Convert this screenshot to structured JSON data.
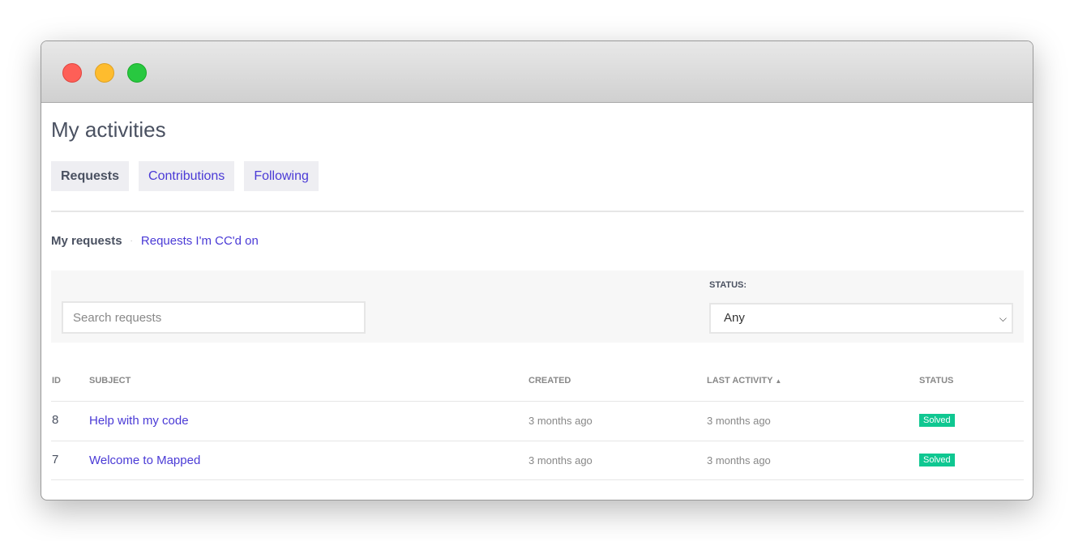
{
  "window": {
    "controls": [
      {
        "name": "close",
        "color": "#fe5f57"
      },
      {
        "name": "minimize",
        "color": "#febc2e"
      },
      {
        "name": "zoom",
        "color": "#28c840"
      }
    ]
  },
  "page": {
    "title": "My activities"
  },
  "tabs": [
    {
      "label": "Requests",
      "active": true
    },
    {
      "label": "Contributions"
    },
    {
      "label": "Following"
    }
  ],
  "subnav": {
    "my_requests": "My requests",
    "separator": "·",
    "cc": "Requests I'm CC'd on"
  },
  "filter": {
    "search_placeholder": "Search requests",
    "status_label": "STATUS:",
    "status_value": "Any"
  },
  "table": {
    "headers": {
      "id": "ID",
      "subject": "SUBJECT",
      "created": "CREATED",
      "last_activity": "LAST ACTIVITY",
      "status": "STATUS"
    },
    "rows": [
      {
        "id": "8",
        "subject": "Help with my code",
        "created": "3 months ago",
        "last_activity": "3 months ago",
        "status": "Solved"
      },
      {
        "id": "7",
        "subject": "Welcome to Mapped",
        "created": "3 months ago",
        "last_activity": "3 months ago",
        "status": "Solved"
      }
    ]
  },
  "colors": {
    "accent": "#4a3ad6",
    "solved": "#0fc791"
  }
}
